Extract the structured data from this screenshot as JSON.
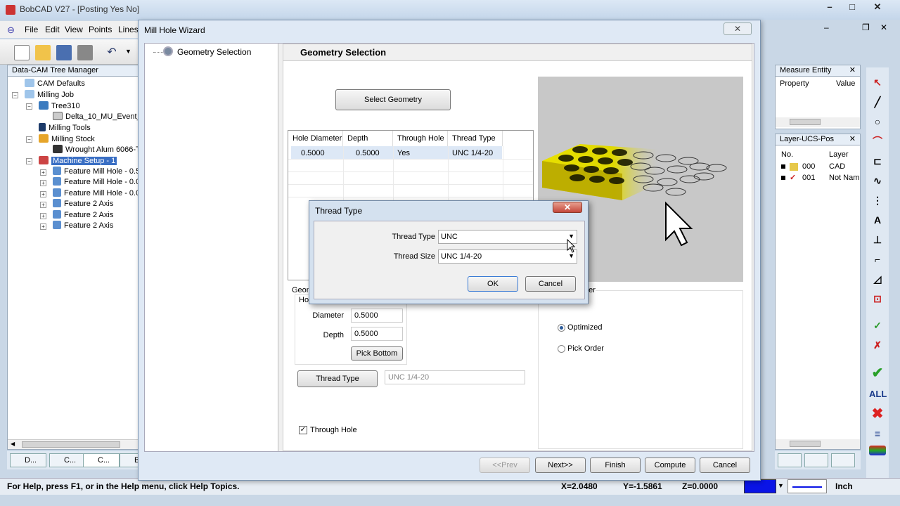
{
  "app": {
    "title": "BobCAD V27 - [Posting Yes No]",
    "menus": [
      "File",
      "Edit",
      "View",
      "Points",
      "Lines"
    ]
  },
  "tree": {
    "header": "Data-CAM Tree Manager",
    "items": [
      "CAM Defaults",
      "Milling Job",
      "Tree310",
      "Delta_10_MU_Event_",
      "Milling Tools",
      "Milling Stock",
      "Wrought Alum 6066-T",
      "Machine Setup - 1",
      "Feature Mill Hole - 0.5",
      "Feature Mill Hole - 0.0",
      "Feature Mill Hole - 0.0",
      "Feature 2 Axis",
      "Feature 2 Axis",
      "Feature 2 Axis"
    ],
    "tabs": [
      "D...",
      "C...",
      "C...",
      "B"
    ]
  },
  "status": {
    "help": "For Help, press F1, or in the Help menu, click Help Topics.",
    "x": "X=2.0480",
    "y": "Y=-1.5861",
    "z": "Z=0.0000",
    "units": "Inch"
  },
  "measure_panel": {
    "title": "Measure Entity",
    "col_property": "Property",
    "col_value": "Value"
  },
  "layer_panel": {
    "title": "Layer-UCS-Pos",
    "col_no": "No.",
    "col_layer": "Layer",
    "rows": [
      {
        "no": "000",
        "layer": "CAD"
      },
      {
        "no": "001",
        "layer": "Not Nam"
      }
    ]
  },
  "right_toolbar": {
    "all_label": "ALL"
  },
  "wizard": {
    "title": "Mill Hole Wizard",
    "nav_item": "Geometry Selection",
    "header": "Geometry Selection",
    "select_geometry": "Select Geometry",
    "table": {
      "headers": [
        "Hole Diameter",
        "Depth",
        "Through Hole",
        "Thread Type"
      ],
      "rows": [
        [
          "0.5000",
          "0.5000",
          "Yes",
          "UNC  1/4-20"
        ]
      ]
    },
    "geometry_group": "Geom",
    "hole_group": "Hol",
    "diameter_label": "Diameter",
    "diameter_value": "0.5000",
    "depth_label": "Depth",
    "depth_value": "0.5000",
    "pick_bottom": "Pick Bottom",
    "thread_type_button": "Thread Type",
    "thread_type_value": "UNC  1/4-20",
    "through_hole": "Through Hole",
    "order_group": "der",
    "optimized": "Optimized",
    "pick_order": "Pick Order",
    "buttons": {
      "prev": "<<Prev",
      "next": "Next>>",
      "finish": "Finish",
      "compute": "Compute",
      "cancel": "Cancel"
    }
  },
  "dialog": {
    "title": "Thread Type",
    "thread_type_label": "Thread Type",
    "thread_type_value": "UNC",
    "thread_size_label": "Thread Size",
    "thread_size_value": "UNC  1/4-20",
    "ok": "OK",
    "cancel": "Cancel"
  }
}
